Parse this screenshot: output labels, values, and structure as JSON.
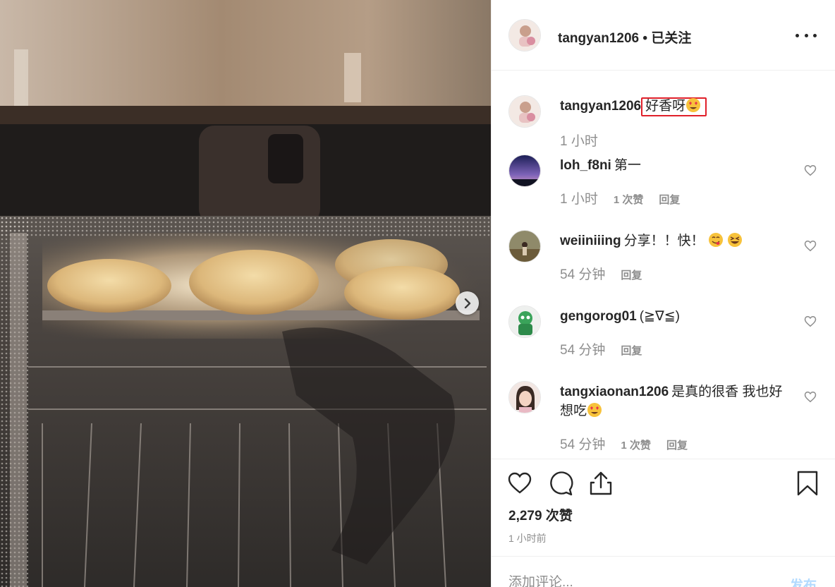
{
  "post": {
    "username": "tangyan1206",
    "separator": "•",
    "follow_status": "已关注"
  },
  "comments": [
    {
      "username": "tangyan1206",
      "text": "好香呀",
      "emoji": "heart-eyes-emoji",
      "time": "1 小时",
      "likes": "",
      "reply": ""
    },
    {
      "username": "loh_f8ni",
      "text": "第一",
      "time": "1 小时",
      "likes": "1 次赞",
      "reply": "回复"
    },
    {
      "username": "weiiniiing",
      "text": "分享！！快！",
      "emoji": "yum-emoji laughing-emoji",
      "time": "54 分钟",
      "likes": "",
      "reply": "回复"
    },
    {
      "username": "gengorog01",
      "text": "(≧∇≦)",
      "time": "54 分钟",
      "likes": "",
      "reply": "回复"
    },
    {
      "username": "tangxiaonan1206",
      "text": "是真的很香 我也好想吃",
      "emoji": "heart-eyes-emoji",
      "time": "54 分钟",
      "likes": "1 次赞",
      "reply": "回复"
    }
  ],
  "actions": {
    "like_icon": "heart-icon",
    "comment_icon": "comment-icon",
    "share_icon": "share-icon",
    "save_icon": "bookmark-icon"
  },
  "stats": {
    "likes": "2,279 次赞",
    "time_ago": "1 小时前"
  },
  "comment_box": {
    "placeholder": "添加评论...",
    "post_label": "发布"
  },
  "colors": {
    "highlight": "#e0202a",
    "post_disabled": "#b3dbff",
    "muted": "#8e8e8e"
  }
}
